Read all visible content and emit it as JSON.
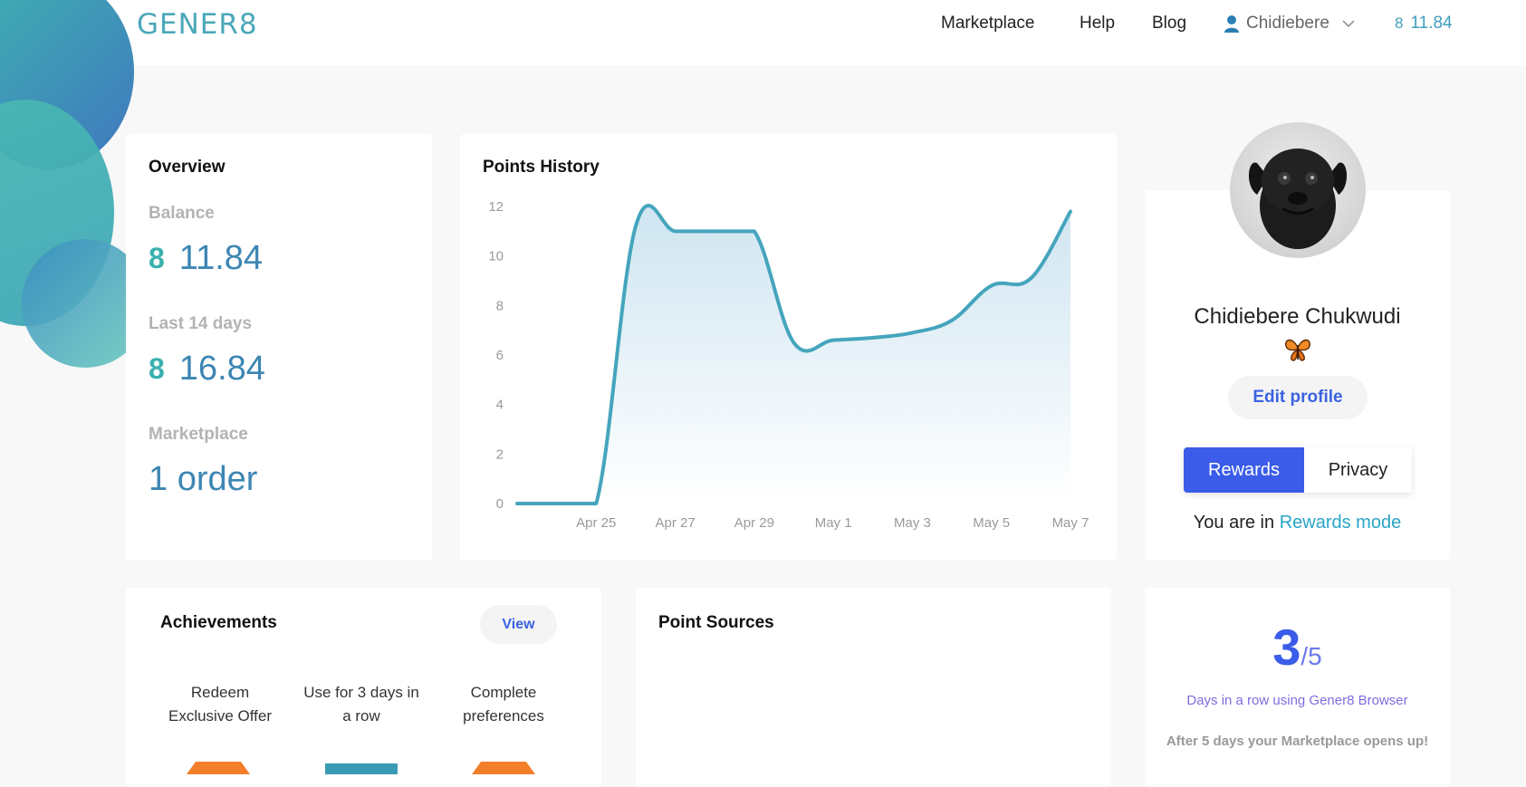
{
  "header": {
    "logo": "GENER8",
    "nav": [
      "Marketplace",
      "Help",
      "Blog"
    ],
    "user_name": "Chidiebere",
    "balance": "11.84",
    "currency_icon": "gener8-coin-icon"
  },
  "overview": {
    "title": "Overview",
    "balance_label": "Balance",
    "balance_value": "11.84",
    "last14_label": "Last 14 days",
    "last14_value": "16.84",
    "marketplace_label": "Marketplace",
    "marketplace_value": "1 order"
  },
  "points_history": {
    "title": "Points History"
  },
  "chart_data": {
    "type": "area",
    "title": "Points History",
    "xlabel": "",
    "ylabel": "",
    "x": [
      "Apr 23",
      "Apr 24",
      "Apr 25",
      "Apr 26",
      "Apr 27",
      "Apr 28",
      "Apr 29",
      "Apr 30",
      "May 1",
      "May 2",
      "May 3",
      "May 4",
      "May 5",
      "May 6",
      "May 7"
    ],
    "values": [
      0,
      0,
      0,
      11.2,
      11,
      11,
      11,
      6.5,
      6.6,
      6.7,
      6.9,
      7.4,
      8.8,
      9.1,
      11.8
    ],
    "x_tick_labels": [
      "Apr 25",
      "Apr 27",
      "Apr 29",
      "May 1",
      "May 3",
      "May 5",
      "May 7"
    ],
    "y_ticks": [
      0,
      2,
      4,
      6,
      8,
      10,
      12
    ],
    "ylim": [
      0,
      12
    ],
    "grid": false,
    "legend": "none",
    "line_color": "#45a5bd"
  },
  "profile": {
    "full_name": "Chidiebere Chukwudi",
    "badge_icon": "butterfly-icon",
    "edit_label": "Edit profile",
    "mode_rewards": "Rewards",
    "mode_privacy": "Privacy",
    "mode_text_prefix": "You are in",
    "mode_text_link": "Rewards mode"
  },
  "achievements": {
    "title": "Achievements",
    "view_label": "View",
    "items": [
      {
        "label": "Redeem Exclusive Offer",
        "color": "#f37f2b"
      },
      {
        "label": "Use for 3 days in a row",
        "color": "#3a9bb5"
      },
      {
        "label": "Complete preferences",
        "color": "#f37f2b"
      }
    ]
  },
  "point_sources": {
    "title": "Point Sources"
  },
  "streak": {
    "current": "3",
    "total": "/5",
    "description": "Days in a row using Gener8 Browser",
    "note": "After 5 days your Marketplace opens up!"
  },
  "colors": {
    "accent": "#3b5ce8",
    "teal": "#45a5bd"
  }
}
